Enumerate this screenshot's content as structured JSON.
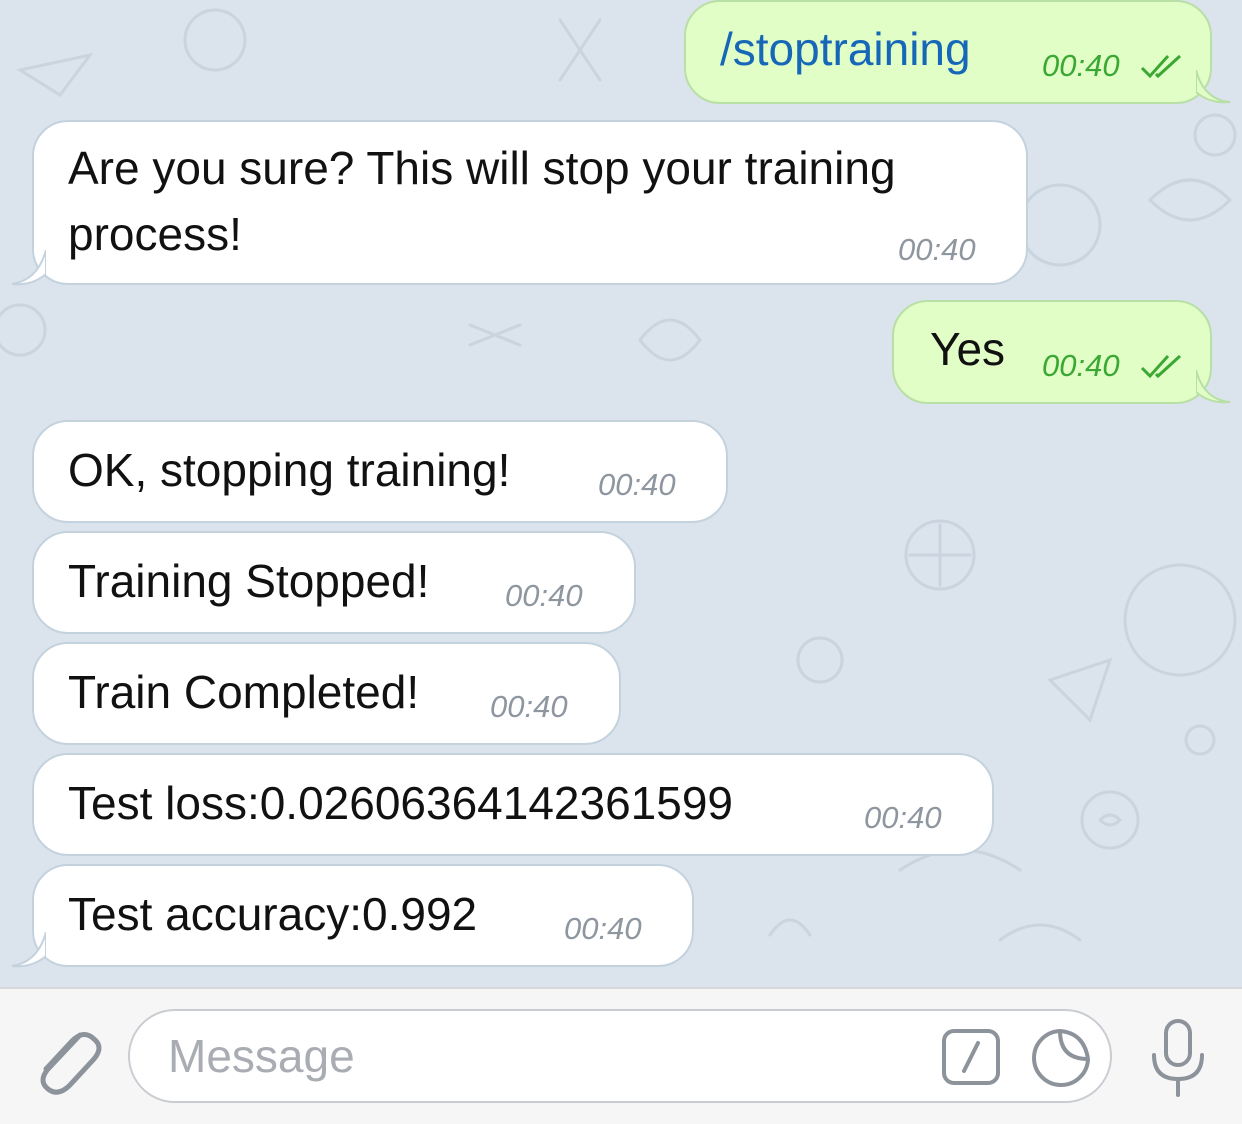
{
  "messages": [
    {
      "direction": "outgoing",
      "text": "/stoptraining",
      "time": "00:40",
      "is_command": true
    },
    {
      "direction": "incoming",
      "lines": [
        "Are you sure? This will stop your training",
        "process!"
      ],
      "time": "00:40"
    },
    {
      "direction": "outgoing",
      "text": "Yes",
      "time": "00:40"
    },
    {
      "direction": "incoming",
      "text": "OK, stopping training!",
      "time": "00:40"
    },
    {
      "direction": "incoming",
      "text": "Training Stopped!",
      "time": "00:40"
    },
    {
      "direction": "incoming",
      "text": "Train Completed!",
      "time": "00:40"
    },
    {
      "direction": "incoming",
      "text": "Test loss:0.026063641423615​99",
      "time": "00:40"
    },
    {
      "direction": "incoming",
      "text": "Test accuracy:0.992",
      "time": "00:40"
    }
  ],
  "input": {
    "placeholder": "Message"
  },
  "icons": {
    "attach": "paperclip-icon",
    "command": "slash-command-icon",
    "sticker": "sticker-icon",
    "mic": "microphone-icon",
    "read": "double-check-icon"
  },
  "colors": {
    "background": "#dbe3ec",
    "incoming_bubble": "#ffffff",
    "outgoing_bubble": "#e1fec6",
    "command_text": "#1767b8",
    "outgoing_time": "#3aa833",
    "incoming_time": "#8e96a0",
    "icon_gray": "#8d939b"
  }
}
